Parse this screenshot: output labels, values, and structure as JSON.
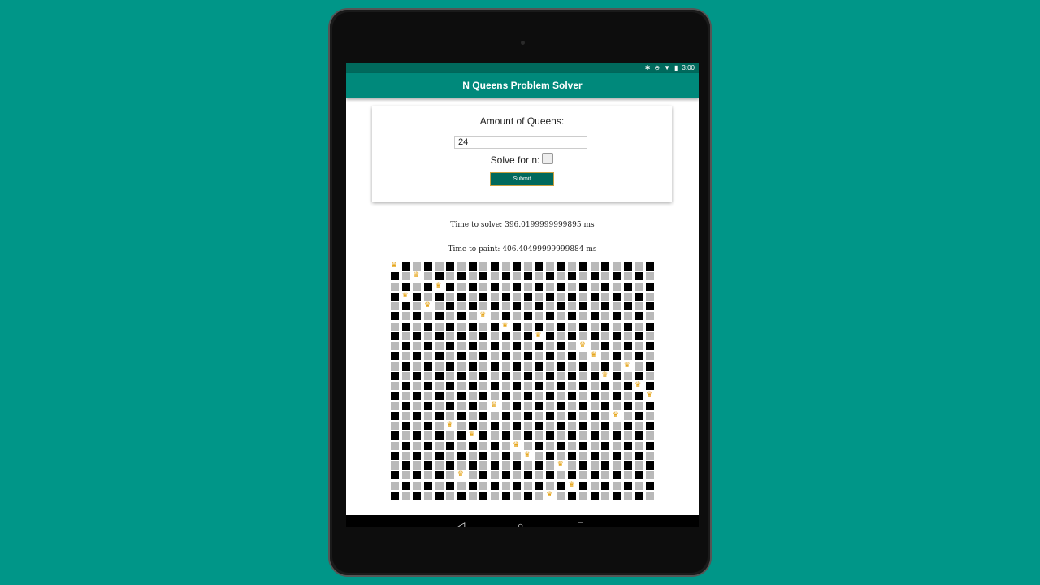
{
  "statusbar": {
    "time": "3:00",
    "icons": [
      "bluetooth-icon",
      "do-not-disturb-icon",
      "wifi-icon",
      "battery-icon"
    ]
  },
  "appbar": {
    "title": "N Queens Problem Solver"
  },
  "form": {
    "amount_label": "Amount of Queens:",
    "amount_value": "24",
    "solve_label": "Solve for n:",
    "solve_checked": false,
    "submit_label": "Submit"
  },
  "stats": {
    "time_to_solve": "Time to solve: 396.0199999999895 ms",
    "time_to_paint": "Time to paint: 406.40499999999884 ms"
  },
  "board": {
    "size": 24,
    "queen_columns": [
      0,
      2,
      4,
      1,
      3,
      8,
      10,
      13,
      17,
      18,
      21,
      19,
      22,
      23,
      9,
      20,
      5,
      7,
      11,
      12,
      15,
      6,
      16,
      14
    ],
    "queen_icon": "crown-icon"
  },
  "navbar": {
    "back": "◁",
    "home": "○",
    "recents": "□"
  },
  "colors": {
    "background": "#009688",
    "appbar": "#00897b",
    "statusbar": "#00695c",
    "submit": "#00695c",
    "dark_square": "#000000",
    "light_square": "#b9b9b9",
    "queen": "#e39b00"
  }
}
